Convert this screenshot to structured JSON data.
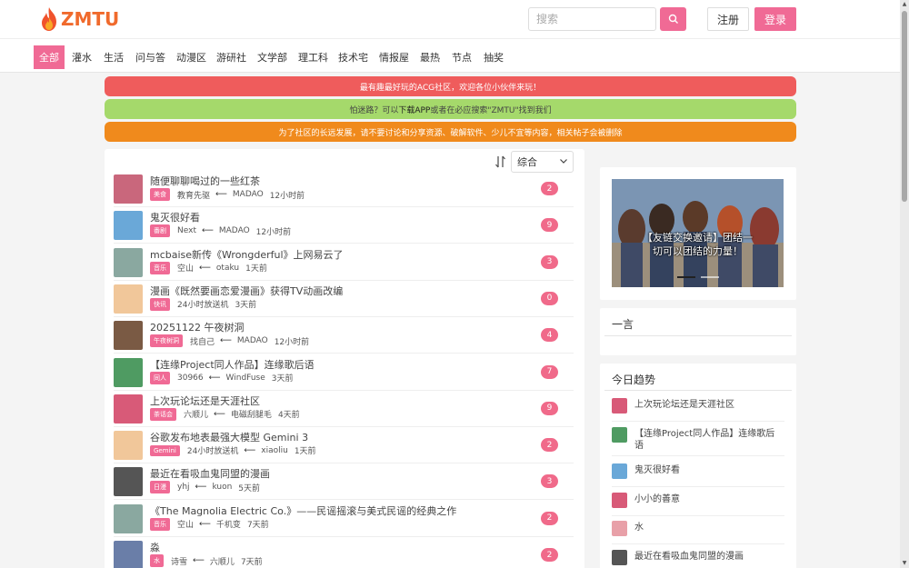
{
  "brand": {
    "name": "ZMTU",
    "color": "#f06a2c",
    "accent": "#f06a95"
  },
  "header": {
    "search_placeholder": "搜索",
    "search_icon": "search-icon",
    "register": "注册",
    "login": "登录"
  },
  "nav": [
    "全部",
    "灌水",
    "生活",
    "问与答",
    "动漫区",
    "游研社",
    "文学部",
    "理工科",
    "技术宅",
    "情报屋",
    "最热",
    "节点",
    "抽奖"
  ],
  "nav_active": "全部",
  "notices": {
    "n1": "最有趣最好玩的ACG社区，欢迎各位小伙伴来玩！",
    "n2_a": "怕迷路？可以",
    "n2_link": "下载APP",
    "n2_b": "或者在必应搜索\"ZMTU\"找到我们",
    "n3": "为了社区的长远发展，请不要讨论和分享资源、破解软件、少儿不宜等内容，相关帖子会被删除"
  },
  "sort": {
    "label": "综合"
  },
  "posts": [
    {
      "title": "随便聊聊喝过的一些红茶",
      "tag": "美食",
      "author": "教育先驱",
      "last": "MADAO",
      "time": "12小时前",
      "count": "2",
      "avatar_color": "#c9677c"
    },
    {
      "title": "鬼灭很好看",
      "tag": "番剧",
      "author": "Next",
      "last": "MADAO",
      "time": "12小时前",
      "count": "9",
      "avatar_color": "#6aa8d8"
    },
    {
      "title": "mcbaise新传《Wrongderful》上网易云了",
      "tag": "音乐",
      "author": "空山",
      "last": "otaku",
      "time": "1天前",
      "count": "3",
      "avatar_color": "#8aa8a0"
    },
    {
      "title": "漫画《既然要画恋爱漫画》获得TV动画改编",
      "tag": "快讯",
      "author": "24小时放送机",
      "last": "",
      "time": "3天前",
      "count": "0",
      "avatar_color": "#f1c79a"
    },
    {
      "title": "20251122 午夜树洞",
      "tag": "午夜树洞",
      "author": "找自己",
      "last": "MADAO",
      "time": "12小时前",
      "count": "4",
      "avatar_color": "#7a5a44"
    },
    {
      "title": "【连缘Project同人作品】连缘歌后语",
      "tag": "同人",
      "author": "30966",
      "last": "WindFuse",
      "time": "3天前",
      "count": "7",
      "avatar_color": "#4f9b62"
    },
    {
      "title": "上次玩论坛还是天涯社区",
      "tag": "茶话会",
      "author": "六顺儿",
      "last": "电磁刮腿毛",
      "time": "4天前",
      "count": "9",
      "avatar_color": "#d85a78"
    },
    {
      "title": "谷歌发布地表最强大模型 Gemini 3",
      "tag": "Gemini",
      "author": "24小时放送机",
      "last": "xiaoliu",
      "time": "1天前",
      "count": "2",
      "avatar_color": "#f1c79a"
    },
    {
      "title": "最近在看吸血鬼同盟的漫画",
      "tag": "日漫",
      "author": "yhj",
      "last": "kuon",
      "time": "5天前",
      "count": "3",
      "avatar_color": "#555555"
    },
    {
      "title": "《The Magnolia Electric Co.》——民谣摇滚与美式民谣的经典之作",
      "tag": "音乐",
      "author": "空山",
      "last": "千机变",
      "time": "7天前",
      "count": "2",
      "avatar_color": "#8aa8a0"
    },
    {
      "title": "淼",
      "tag": "水",
      "author": "诗雪",
      "last": "六顺儿",
      "time": "7天前",
      "count": "2",
      "avatar_color": "#6a7ea8"
    }
  ],
  "banner": {
    "caption_1": "【友链交换邀请】团结一",
    "caption_2": "切可以团结的力量！"
  },
  "yiyan": {
    "title": "一言"
  },
  "trend": {
    "title": "今日趋势",
    "items": [
      {
        "text": "上次玩论坛还是天涯社区",
        "color": "#d85a78"
      },
      {
        "text": "【连缘Project同人作品】连缘歌后语",
        "color": "#4f9b62"
      },
      {
        "text": "鬼灭很好看",
        "color": "#6aa8d8"
      },
      {
        "text": "小小的善意",
        "color": "#d85a78"
      },
      {
        "text": "水",
        "color": "#e8a0a8"
      },
      {
        "text": "最近在看吸血鬼同盟的漫画",
        "color": "#555555"
      }
    ]
  }
}
